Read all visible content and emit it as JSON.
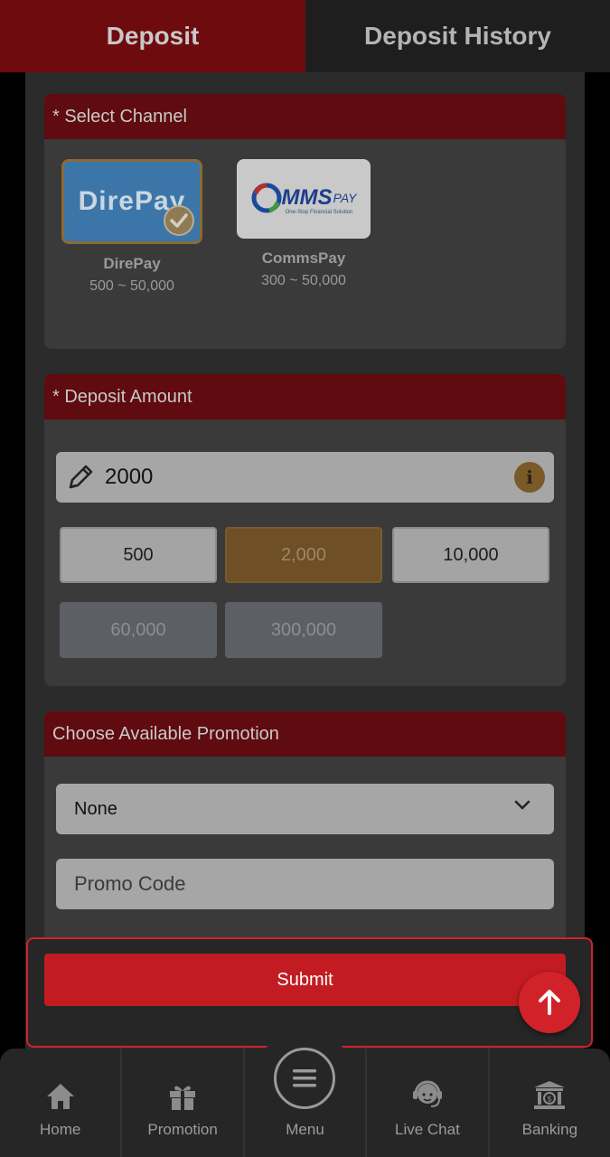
{
  "tabs": {
    "deposit": "Deposit",
    "history": "Deposit History"
  },
  "channel_section": {
    "title": "* Select Channel",
    "channels": [
      {
        "name": "DirePay",
        "range": "500 ~ 50,000",
        "logo_text": "DirePay",
        "selected": true
      },
      {
        "name": "CommsPay",
        "range": "300 ~ 50,000",
        "logo_text": "MMS",
        "logo_sub": "PAY",
        "logo_tagline": "One-Stop Financial Solution",
        "selected": false
      }
    ]
  },
  "amount_section": {
    "title": "* Deposit Amount",
    "value": "2000",
    "info": "i",
    "chips": [
      {
        "label": "500",
        "state": "normal"
      },
      {
        "label": "2,000",
        "state": "active"
      },
      {
        "label": "10,000",
        "state": "normal"
      },
      {
        "label": "60,000",
        "state": "disabled"
      },
      {
        "label": "300,000",
        "state": "disabled"
      }
    ]
  },
  "promotion_section": {
    "title": "Choose Available Promotion",
    "selected": "None",
    "promo_placeholder": "Promo Code"
  },
  "submit_label": "Submit",
  "nav": [
    {
      "label": "Home",
      "icon": "home-icon"
    },
    {
      "label": "Promotion",
      "icon": "gift-icon"
    },
    {
      "label": "Menu",
      "icon": "menu-icon"
    },
    {
      "label": "Live Chat",
      "icon": "headset-icon"
    },
    {
      "label": "Banking",
      "icon": "bank-icon"
    }
  ],
  "colors": {
    "accent": "#c21c22",
    "header_red": "#5f0b0f",
    "gold": "#6e4f26"
  }
}
